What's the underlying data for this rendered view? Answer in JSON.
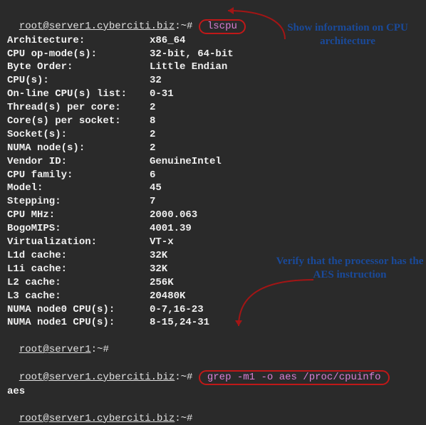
{
  "prompts": {
    "p1": "root@server1.cyberciti.biz",
    "p1suffix": ":~#",
    "p2short": "root@server1",
    "p2suffix": ":~#",
    "cmd1": "lscpu",
    "cmd2": "grep -m1 -o aes /proc/cpuinfo",
    "out_aes": "aes"
  },
  "annotations": {
    "a1": "Show information on CPU architecture",
    "a2": "Verify that the processor has the AES instruction"
  },
  "lscpu": [
    {
      "k": "Architecture:",
      "v": "x86_64"
    },
    {
      "k": "CPU op-mode(s):",
      "v": "32-bit, 64-bit"
    },
    {
      "k": "Byte Order:",
      "v": "Little Endian"
    },
    {
      "k": "CPU(s):",
      "v": "32"
    },
    {
      "k": "On-line CPU(s) list:",
      "v": "0-31"
    },
    {
      "k": "Thread(s) per core:",
      "v": "2"
    },
    {
      "k": "Core(s) per socket:",
      "v": "8"
    },
    {
      "k": "Socket(s):",
      "v": "2"
    },
    {
      "k": "NUMA node(s):",
      "v": "2"
    },
    {
      "k": "Vendor ID:",
      "v": "GenuineIntel"
    },
    {
      "k": "CPU family:",
      "v": "6"
    },
    {
      "k": "Model:",
      "v": "45"
    },
    {
      "k": "Stepping:",
      "v": "7"
    },
    {
      "k": "CPU MHz:",
      "v": "2000.063"
    },
    {
      "k": "BogoMIPS:",
      "v": "4001.39"
    },
    {
      "k": "Virtualization:",
      "v": "VT-x"
    },
    {
      "k": "L1d cache:",
      "v": "32K"
    },
    {
      "k": "L1i cache:",
      "v": "32K"
    },
    {
      "k": "L2 cache:",
      "v": "256K"
    },
    {
      "k": "L3 cache:",
      "v": "20480K"
    },
    {
      "k": "NUMA node0 CPU(s):",
      "v": "0-7,16-23"
    },
    {
      "k": "NUMA node1 CPU(s):",
      "v": "8-15,24-31"
    }
  ]
}
